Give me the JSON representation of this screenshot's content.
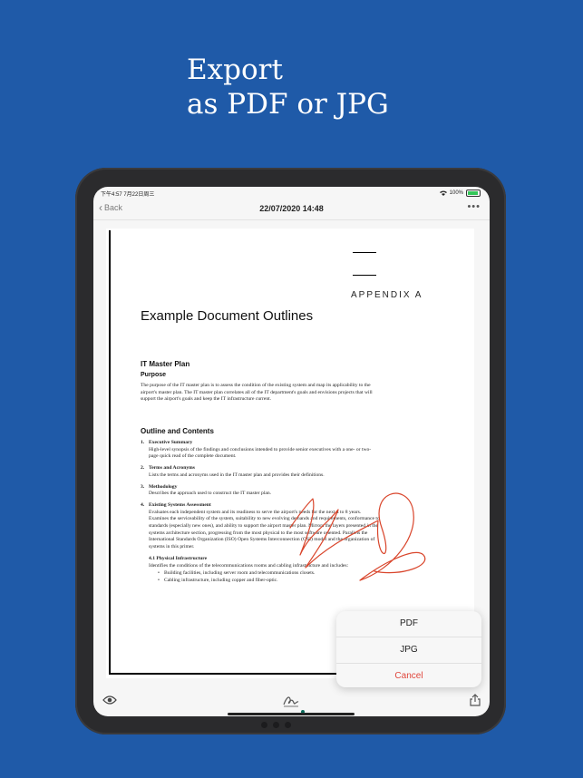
{
  "headline": {
    "line1": "Export",
    "line2": "as PDF or JPG"
  },
  "status": {
    "time": "下午4:57  7月22日周三",
    "battery": "100%"
  },
  "nav": {
    "back_label": "Back",
    "title": "22/07/2020 14:48",
    "more": "•••"
  },
  "document": {
    "appendix": "APPENDIX A",
    "title": "Example Document Outlines",
    "section1": "IT Master Plan",
    "purpose_heading": "Purpose",
    "purpose_text": "The purpose of the IT master plan is to assess the condition of the existing system and map its applicability to the airport's master plan. The IT master plan correlates all of the IT department's goals and envisions projects that will support the airport's goals and keep the IT infrastructure current.",
    "outline_heading": "Outline and Contents",
    "items": [
      {
        "num": "1.",
        "title": "Executive Summary",
        "text": "High-level synopsis of the findings and conclusions intended to provide senior executives with a one- or two-page quick read of the complete document."
      },
      {
        "num": "2.",
        "title": "Terms and Acronyms",
        "text": "Lists the terms and acronyms used in the IT master plan and provides their definitions."
      },
      {
        "num": "3.",
        "title": "Methodology",
        "text": "Describes the approach used to construct the IT master plan."
      },
      {
        "num": "4.",
        "title": "Existing Systems Assessment",
        "text": "Evaluates each independent system and its readiness to serve the airport's needs for the next 4 to 8 years. Examines the serviceability of the system, suitability to new evolving demands and requirements, conformance to standards (especially new ones), and ability to support the airport master plan. Mirrors the layers presented in the systems architecture section, progressing from the most physical to the most software oriented. Parallels the International Standards Organization (ISO) Open Systems Interconnection (OSI) model and the organization of systems in this primer."
      }
    ],
    "sub_title": "4.1 Physical Infrastructure",
    "sub_text": "Identifies the conditions of the telecommunications rooms and cabling infrastructure and includes:",
    "bullets": [
      "Building facilities, including server room and telecommunications closets.",
      "Cabling infrastructure, including copper and fiber-optic."
    ]
  },
  "menu": {
    "pdf": "PDF",
    "jpg": "JPG",
    "cancel": "Cancel"
  },
  "colors": {
    "background": "#1f5aa8",
    "cancel": "#e0463c",
    "signature": "#d9452b"
  }
}
